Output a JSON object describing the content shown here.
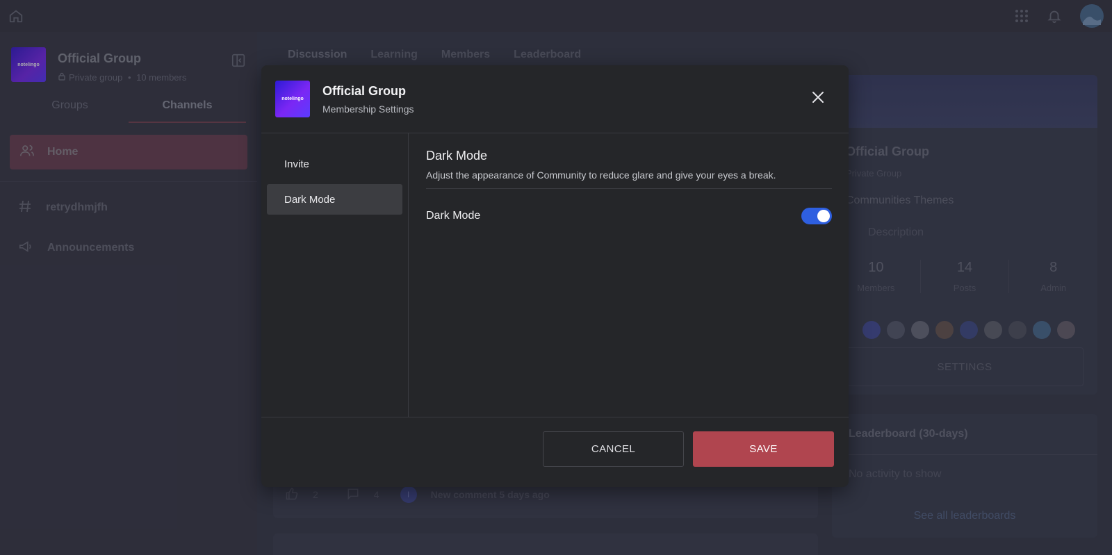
{
  "group": {
    "name": "Official Group",
    "logo_text": "notelingo",
    "privacy": "Private group",
    "members_label": "10 members"
  },
  "sidebar": {
    "tabs": [
      {
        "label": "Groups"
      },
      {
        "label": "Channels"
      }
    ],
    "items": [
      {
        "label": "Home"
      },
      {
        "label": "retrydhmjfh"
      },
      {
        "label": "Announcements"
      }
    ]
  },
  "main": {
    "tabs": [
      {
        "label": "Discussion"
      },
      {
        "label": "Learning"
      },
      {
        "label": "Members"
      },
      {
        "label": "Leaderboard"
      }
    ],
    "post_actions": {
      "likes": "2",
      "comments": "4",
      "badge": "I",
      "last_activity": "New comment 5 days ago"
    }
  },
  "right_panel": {
    "title": "Official Group",
    "privacy": "Private Group",
    "themes": "Communities Themes",
    "description": "Description",
    "stats": [
      {
        "value": "10",
        "label": "Members"
      },
      {
        "value": "14",
        "label": "Posts"
      },
      {
        "value": "8",
        "label": "Admin"
      }
    ],
    "settings_label": "SETTINGS",
    "leaderboard": {
      "title": "Leaderboard (30-days)",
      "empty": "No activity to show",
      "link": "See all leaderboards"
    }
  },
  "modal": {
    "title": "Official Group",
    "subtitle": "Membership Settings",
    "menu": [
      {
        "label": "Invite"
      },
      {
        "label": "Dark Mode"
      }
    ],
    "section": {
      "title": "Dark Mode",
      "description": "Adjust the appearance of Community to reduce glare and give your eyes a break.",
      "toggle_label": "Dark Mode",
      "toggle_on": true
    },
    "cancel_label": "CANCEL",
    "save_label": "SAVE"
  },
  "colors": {
    "accent_save": "#b0454f",
    "toggle_on": "#2e5fe0",
    "modal_bg": "#252629"
  }
}
